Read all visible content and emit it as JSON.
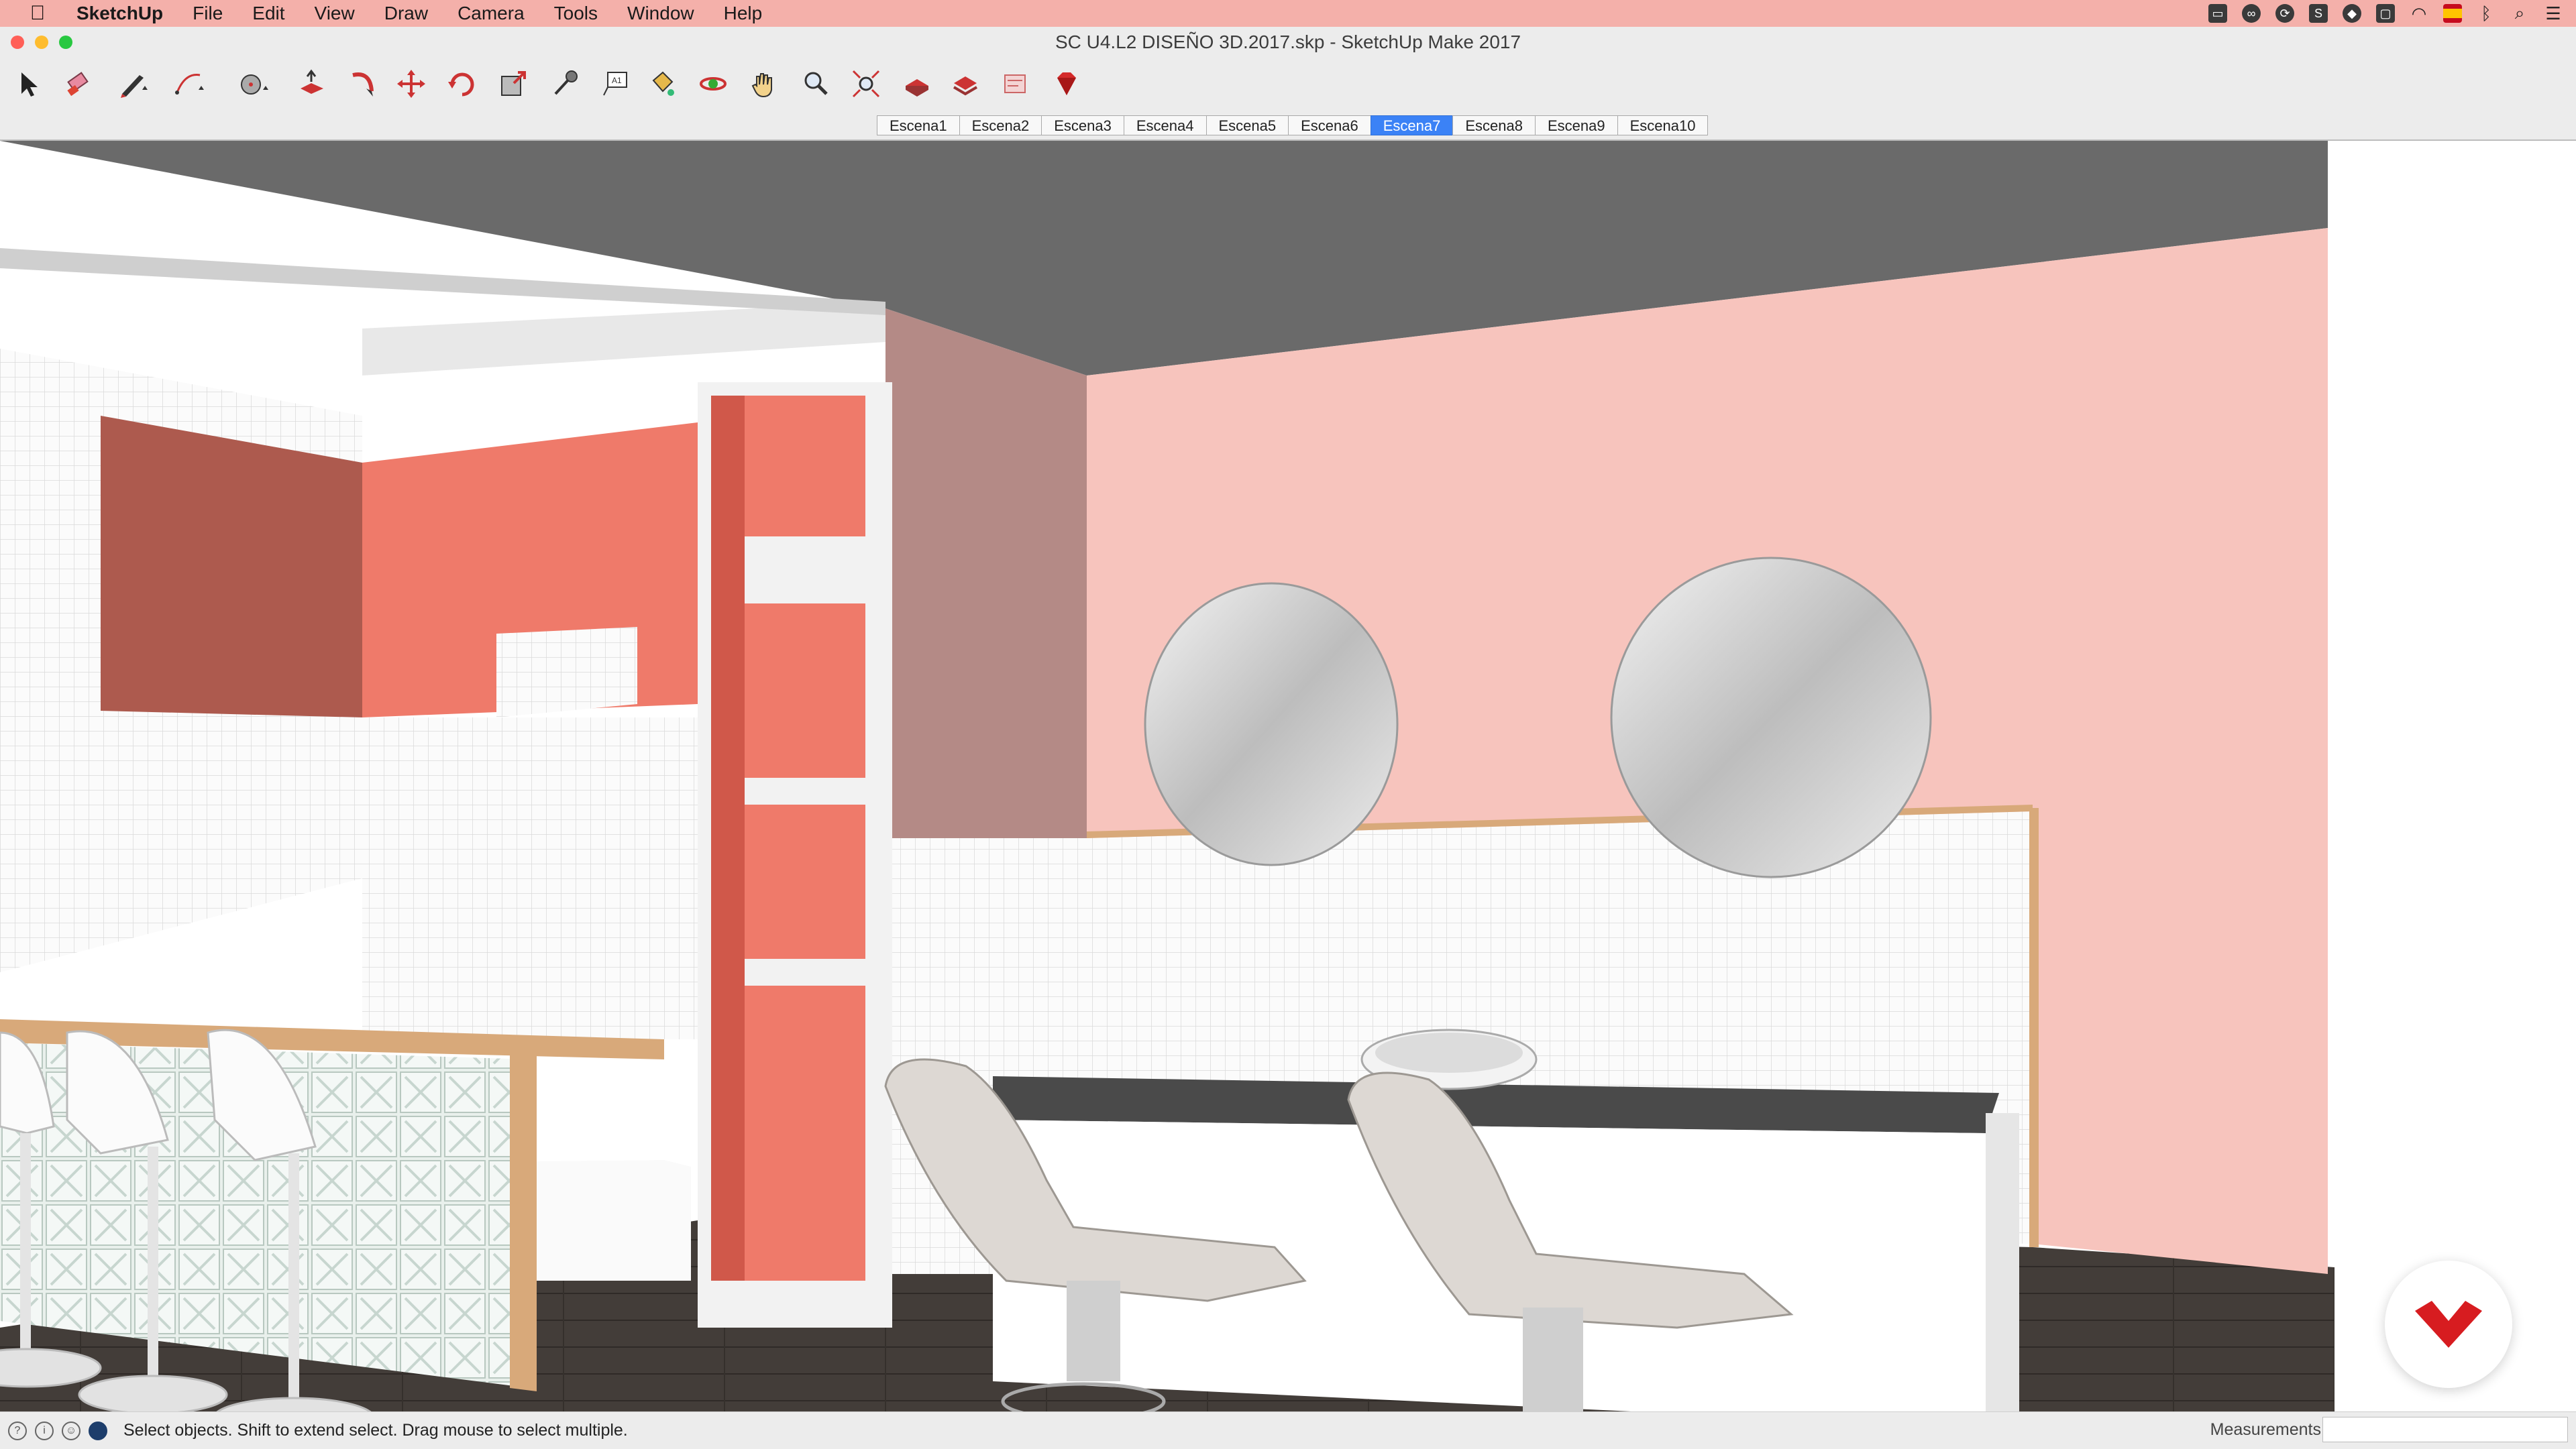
{
  "menubar": {
    "app_name": "SketchUp",
    "items": [
      "File",
      "Edit",
      "View",
      "Draw",
      "Camera",
      "Tools",
      "Window",
      "Help"
    ],
    "tray_icons": [
      "screen-mirror-icon",
      "creative-cloud-icon",
      "sync-icon",
      "s-app-icon",
      "dropbox-icon",
      "airplay-icon",
      "wifi-icon",
      "spanish-flag-icon",
      "bluetooth-icon",
      "spotlight-icon",
      "notification-list-icon"
    ]
  },
  "window": {
    "title": "SC U4.L2 DISEÑO 3D.2017.skp - SketchUp Make 2017",
    "traffic_lights": {
      "close": "#ff5f57",
      "minimize": "#febc2e",
      "maximize": "#28c840"
    }
  },
  "toolbar": {
    "tools": [
      "select-tool",
      "eraser-tool",
      "line-tool",
      "arc-tool",
      "shapes-tool",
      "push-pull-tool",
      "follow-me-tool",
      "move-tool",
      "rotate-tool",
      "scale-tool",
      "tape-measure-tool",
      "text-tool",
      "paint-bucket-tool",
      "orbit-tool",
      "pan-tool",
      "zoom-tool",
      "zoom-extents-tool",
      "3d-warehouse-tool",
      "extension-warehouse-tool",
      "layout-tool",
      "ruby-console-tool"
    ]
  },
  "scenes": {
    "tabs": [
      "Escena1",
      "Escena2",
      "Escena3",
      "Escena4",
      "Escena5",
      "Escena6",
      "Escena7",
      "Escena8",
      "Escena9",
      "Escena10"
    ],
    "active_index": 6,
    "active_color": "#3b82f6"
  },
  "status": {
    "text": "Select objects. Shift to extend select. Drag mouse to select multiple.",
    "measurements_label": "Measurements",
    "measurements_value": ""
  },
  "colors": {
    "menubar_bg": "#f4b0aa",
    "ceiling": "#6b6b6b",
    "pink_wall": "#f7c4bd",
    "coral_wall": "#ef7a6a",
    "dark_floor": "#3f3a37",
    "wood_trim": "#d8a97a",
    "logo_red": "#d71c20"
  }
}
